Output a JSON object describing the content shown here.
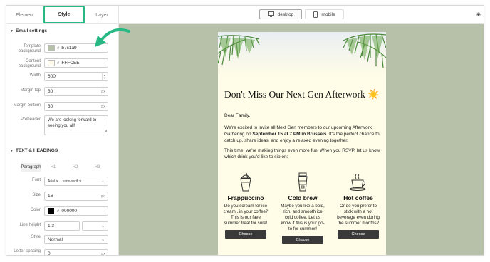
{
  "tabs": {
    "element": "Element",
    "style": "Style",
    "layer": "Layer"
  },
  "email_settings": {
    "heading": "Email settings",
    "template_background": {
      "label": "Template background",
      "value": "b7c1a9",
      "color": "#b7c1a9"
    },
    "content_background": {
      "label": "Content background",
      "value": "FFFCEE",
      "color": "#fffcee"
    },
    "width": {
      "label": "Width",
      "value": "600"
    },
    "margin_top": {
      "label": "Margin top",
      "value": "30",
      "unit": "px"
    },
    "margin_bottom": {
      "label": "Margin bottom",
      "value": "30",
      "unit": "px"
    },
    "preheader": {
      "label": "Preheader",
      "value": "We are looking forward to seeing you all!"
    }
  },
  "text_headings": {
    "heading": "TEXT & HEADINGS",
    "tabs": [
      "Paragraph",
      "H1",
      "H2",
      "H3"
    ],
    "font": {
      "label": "Font",
      "chips": [
        "Arial",
        "sans-serif"
      ]
    },
    "size": {
      "label": "Size",
      "value": "16",
      "unit": "px"
    },
    "color": {
      "label": "Color",
      "value": "000000",
      "color": "#000000"
    },
    "line_height": {
      "label": "Line height",
      "value": "1.3"
    },
    "style": {
      "label": "Style",
      "value": "Normal"
    },
    "letter_spacing": {
      "label": "Letter spacing",
      "value": "0",
      "unit": "px"
    }
  },
  "topbar": {
    "desktop": "desktop",
    "mobile": "mobile"
  },
  "email": {
    "headline": "Don't Miss Our Next Gen Afterwork ☀️",
    "greeting": "Dear Family,",
    "p1_a": "We're excited to invite all Next Gen members to our upcoming Afterwork Gathering on ",
    "p1_b": "September 15 at 7 PM in Brussels",
    "p1_c": ". It's the perfect chance to catch up, share ideas, and enjoy a relaxed evening together.",
    "p2": "This time, we're making things even more fun! When you RSVP, let us know which drink you'd like to sip on:",
    "drinks": [
      {
        "name": "Frappuccino",
        "desc": "Do you scream for ice cream...in your coffee? This is our fave summer treat for sure!",
        "button": "Choose",
        "icon": "frappuccino-icon"
      },
      {
        "name": "Cold brew",
        "desc": "Maybe you like a bold, rich, and smooth ice cold coffee. Let us know if this is your go-to for summer!",
        "button": "Choose",
        "icon": "cold-brew-icon"
      },
      {
        "name": "Hot coffee",
        "desc": "Or do you prefer to stick with a hot beverage even during the summer months?",
        "button": "Choose",
        "icon": "hot-coffee-icon"
      }
    ]
  },
  "colors": {
    "accent": "#28b884",
    "preview_bg": "#b7c1a9",
    "email_bg": "#fffce7",
    "button": "#3a3a3a"
  }
}
